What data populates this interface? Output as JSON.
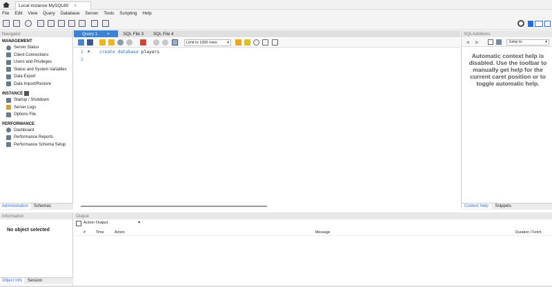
{
  "window": {
    "tab_label": "Local instance MySQL80",
    "tab_close": "×"
  },
  "menu": [
    "File",
    "Edit",
    "View",
    "Query",
    "Database",
    "Server",
    "Tools",
    "Scripting",
    "Help"
  ],
  "navigator": {
    "title": "Navigator",
    "management_header": "MANAGEMENT",
    "management_items": [
      "Server Status",
      "Client Connections",
      "Users and Privileges",
      "Status and System Variables",
      "Data Export",
      "Data Import/Restore"
    ],
    "instance_header": "INSTANCE",
    "instance_items": [
      "Startup / Shutdown",
      "Server Logs",
      "Options File"
    ],
    "performance_header": "PERFORMANCE",
    "performance_items": [
      "Dashboard",
      "Performance Reports",
      "Performance Schema Setup"
    ],
    "tabs": [
      "Administration",
      "Schemas"
    ]
  },
  "information": {
    "title": "Information",
    "no_object": "No object selected",
    "tabs": [
      "Object Info",
      "Session"
    ]
  },
  "query_tabs": [
    {
      "label": "Query 1",
      "active": true,
      "close": "×"
    },
    {
      "label": "SQL File 3",
      "active": false
    },
    {
      "label": "SQL File 4",
      "active": false
    }
  ],
  "query_toolbar": {
    "limit_label": "Limit to 1000 rows"
  },
  "editor": {
    "lines": [
      {
        "num": "1",
        "marker": "●",
        "keywords": "create database",
        "text": " players"
      },
      {
        "num": "2",
        "marker": "",
        "keywords": "",
        "text": ""
      }
    ]
  },
  "sql_additions": {
    "title": "SQLAdditions",
    "jump_label": "Jump to",
    "help_text": "Automatic context help is disabled. Use the toolbar to manually get help for the current caret position or to toggle automatic help.",
    "tabs": [
      "Context Help",
      "Snippets"
    ]
  },
  "output": {
    "title": "Output",
    "selector": "Action Output",
    "columns": [
      "#",
      "Time",
      "Action",
      "Message",
      "Duration / Fetch"
    ]
  },
  "colors": {
    "accent": "#3b82d6",
    "keyword": "#1a6bc7",
    "line_number": "#3d7fd0"
  }
}
